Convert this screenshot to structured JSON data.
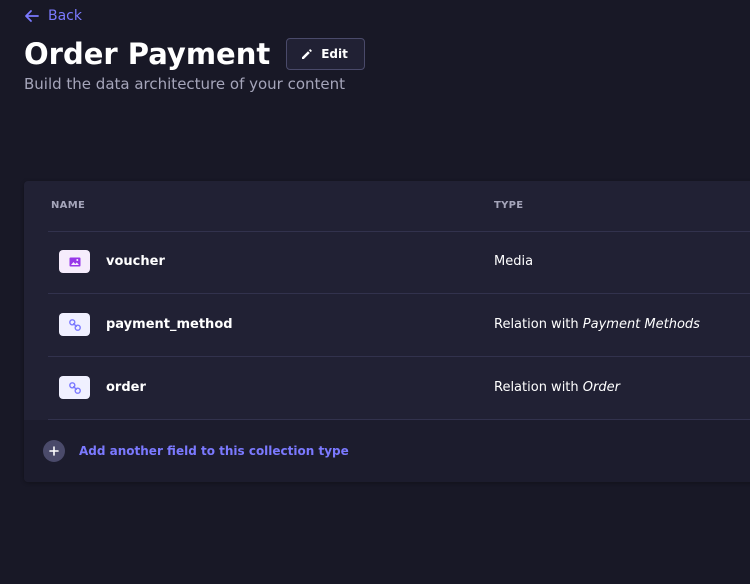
{
  "header": {
    "back_label": "Back",
    "title": "Order Payment",
    "edit_label": "Edit",
    "subtitle": "Build the data architecture of your content"
  },
  "table": {
    "columns": {
      "name": "NAME",
      "type": "TYPE"
    },
    "rows": [
      {
        "name": "voucher",
        "type": "Media",
        "relation_target": "",
        "icon": "media-icon"
      },
      {
        "name": "payment_method",
        "type": "Relation with",
        "relation_target": "Payment Methods",
        "icon": "relation-icon"
      },
      {
        "name": "order",
        "type": "Relation with",
        "relation_target": "Order",
        "icon": "relation-icon"
      }
    ]
  },
  "footer": {
    "add_field_label": "Add another field to this collection type"
  },
  "colors": {
    "background": "#181826",
    "card": "#212134",
    "accent": "#7b79ff",
    "muted_text": "#a5a5ba",
    "media_icon": "#9736e8",
    "relation_icon": "#7b79ff"
  }
}
